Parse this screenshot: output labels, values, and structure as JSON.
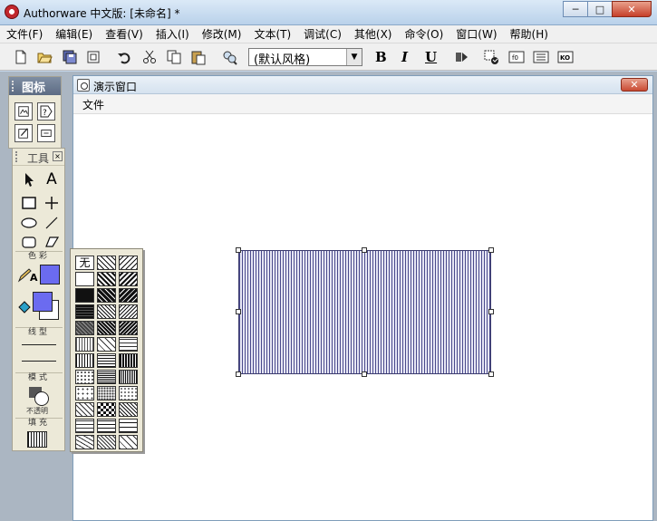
{
  "app": {
    "title": "Authorware 中文版: [未命名] *",
    "window_buttons": {
      "minimize": "─",
      "maximize": "□",
      "close": "✕"
    }
  },
  "menubar": [
    "文件(F)",
    "编辑(E)",
    "查看(V)",
    "插入(I)",
    "修改(M)",
    "文本(T)",
    "调试(C)",
    "其他(X)",
    "命令(O)",
    "窗口(W)",
    "帮助(H)"
  ],
  "toolbar": {
    "style_select": "(默认风格)",
    "bold": "B",
    "italic": "I",
    "underline": "U",
    "icons": [
      "new-icon",
      "open-icon",
      "save-all-icon",
      "import-icon",
      "undo-icon",
      "cut-icon",
      "copy-icon",
      "paste-icon",
      "find-icon",
      "run-icon",
      "control-panel-icon",
      "functions-icon",
      "variables-icon",
      "knowledge-objects-icon"
    ]
  },
  "icon_palette": {
    "title": "图标",
    "icons": [
      "display-icon",
      "decision-icon",
      "calculation-icon",
      "interaction-icon"
    ]
  },
  "tools_panel": {
    "title": "工具",
    "close": "×",
    "text_tool": "A",
    "sections": {
      "color": "色彩",
      "line": "线型",
      "mode": "模式",
      "fill": "填充"
    },
    "line_color_letter": "A",
    "mode_value": "不透明",
    "colors": {
      "foreground": "#6b6bf0",
      "background": "#ffffff",
      "line": "#6b6bf0"
    }
  },
  "pattern_picker": {
    "none_label": "无",
    "selected_pattern": "vertical-lines"
  },
  "presentation_window": {
    "title": "演示窗口",
    "menu": "文件",
    "close": "✕",
    "shape": {
      "type": "rectangle",
      "fill_pattern": "vertical-lines",
      "fill_color": "#4a4a8c"
    }
  }
}
